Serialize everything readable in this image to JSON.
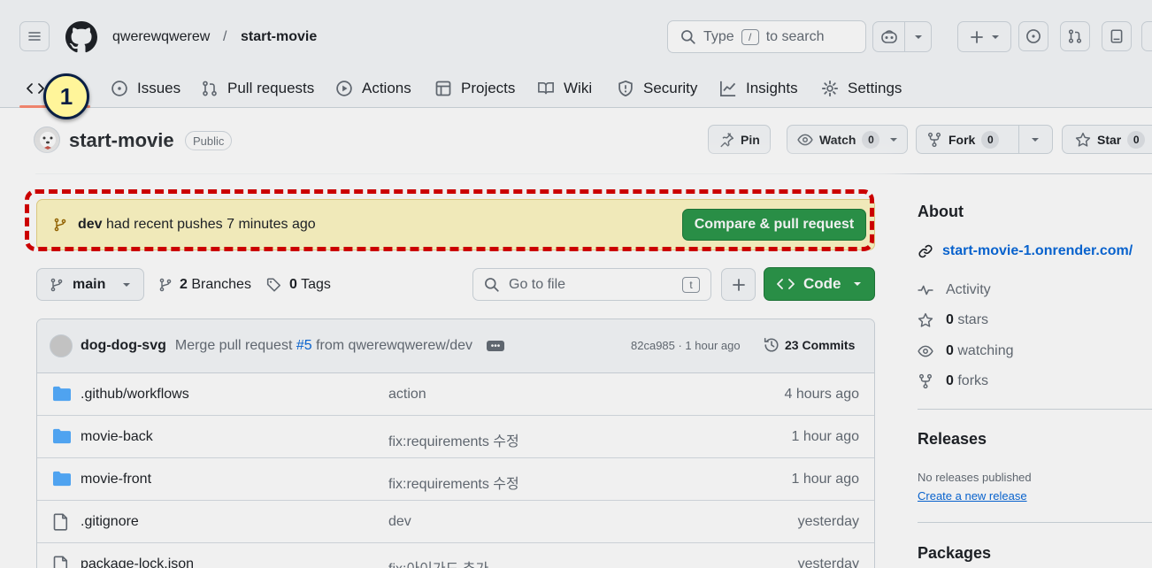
{
  "header": {
    "owner": "qwerewqwerew",
    "separator": "/",
    "repo": "start-movie",
    "search_prefix": "Type",
    "search_key": "/",
    "search_suffix": "to search"
  },
  "nav": {
    "tabs": [
      {
        "label": "Issues"
      },
      {
        "label": "Pull requests"
      },
      {
        "label": "Actions"
      },
      {
        "label": "Projects"
      },
      {
        "label": "Wiki"
      },
      {
        "label": "Security"
      },
      {
        "label": "Insights"
      },
      {
        "label": "Settings"
      }
    ],
    "step_badge": "1"
  },
  "repo": {
    "title": "start-movie",
    "visibility": "Public",
    "pin_label": "Pin",
    "watch_label": "Watch",
    "watch_count": "0",
    "fork_label": "Fork",
    "fork_count": "0",
    "star_label": "Star",
    "star_count": "0"
  },
  "banner": {
    "branch": "dev",
    "text": "had recent pushes 7 minutes ago",
    "button": "Compare & pull request"
  },
  "toolbar": {
    "branch": "main",
    "branches_count": "2",
    "branches_label": "Branches",
    "tags_count": "0",
    "tags_label": "Tags",
    "goto_placeholder": "Go to file",
    "goto_key": "t",
    "code_label": "Code"
  },
  "commit": {
    "author": "dog-dog-svg",
    "message_prefix": "Merge pull request",
    "pr": "#5",
    "message_suffix": "from qwerewqwerew/dev",
    "hash_time": "82ca985 · 1 hour ago",
    "commits_count": "23",
    "commits_label": "Commits"
  },
  "files": [
    {
      "type": "folder",
      "name": ".github/workflows",
      "message": "action",
      "time": "4 hours ago"
    },
    {
      "type": "folder",
      "name": "movie-back",
      "message": "fix:requirements 수정",
      "time": "1 hour ago"
    },
    {
      "type": "folder",
      "name": "movie-front",
      "message": "fix:requirements 수정",
      "time": "1 hour ago"
    },
    {
      "type": "file",
      "name": ".gitignore",
      "message": "dev",
      "time": "yesterday"
    },
    {
      "type": "file",
      "name": "package-lock.json",
      "message": "fix:아이가드 추가",
      "time": "yesterday"
    }
  ],
  "sidebar": {
    "about_title": "About",
    "website": "start-movie-1.onrender.com/",
    "activity": "Activity",
    "stars_count": "0",
    "stars_label": "stars",
    "watching_count": "0",
    "watching_label": "watching",
    "forks_count": "0",
    "forks_label": "forks",
    "releases_title": "Releases",
    "no_releases": "No releases published",
    "create_release": "Create a new release",
    "packages_title": "Packages"
  },
  "colors": {
    "accent_green": "#2c974b",
    "banner_bg": "#fff8c5",
    "highlight_red": "#d80000",
    "link_blue": "#0969da",
    "tab_underline": "#fd8c73"
  }
}
